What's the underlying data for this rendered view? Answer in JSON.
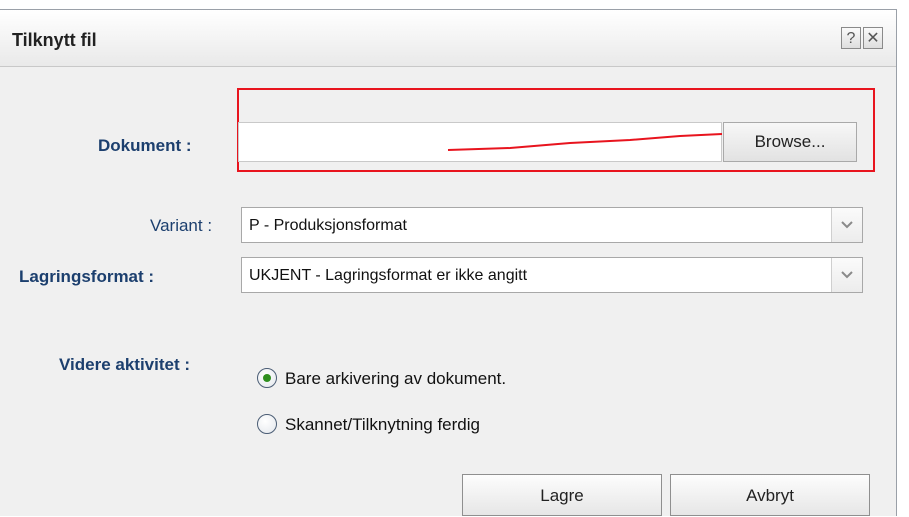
{
  "dialog": {
    "title": "Tilknytt fil",
    "help_label": "?",
    "close_label": "✕"
  },
  "document": {
    "label": "Dokument :",
    "value": "",
    "browse_label": "Browse..."
  },
  "variant": {
    "label": "Variant :",
    "selected": "P - Produksjonsformat"
  },
  "storage_format": {
    "label": "Lagringsformat :",
    "selected": "UKJENT - Lagringsformat er ikke angitt"
  },
  "next_activity": {
    "label": "Videre aktivitet :",
    "options": [
      {
        "label": "Bare arkivering av dokument.",
        "checked": true
      },
      {
        "label": "Skannet/Tilknytning ferdig",
        "checked": false
      }
    ]
  },
  "actions": {
    "save_label": "Lagre",
    "cancel_label": "Avbryt"
  },
  "colors": {
    "label_text": "#1c3f6e",
    "highlight": "#e8141e",
    "radio_dot": "#2f8f1f"
  },
  "icons": {
    "help": "question-mark-icon",
    "close": "close-icon",
    "dropdown": "chevron-down-icon"
  }
}
